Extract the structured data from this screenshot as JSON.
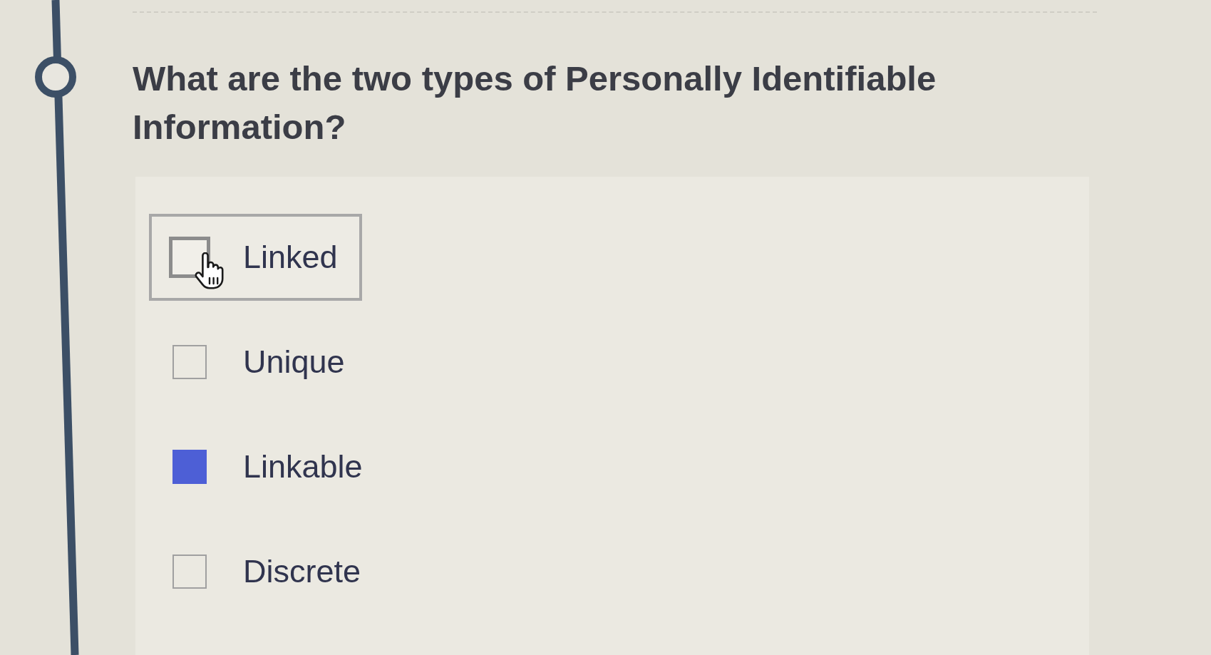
{
  "question": {
    "text": "What are the two types of Personally Identifiable Information?"
  },
  "options": [
    {
      "label": "Linked",
      "checked": false,
      "hovered": true
    },
    {
      "label": "Unique",
      "checked": false,
      "hovered": false
    },
    {
      "label": "Linkable",
      "checked": true,
      "hovered": false
    },
    {
      "label": "Discrete",
      "checked": false,
      "hovered": false
    }
  ]
}
